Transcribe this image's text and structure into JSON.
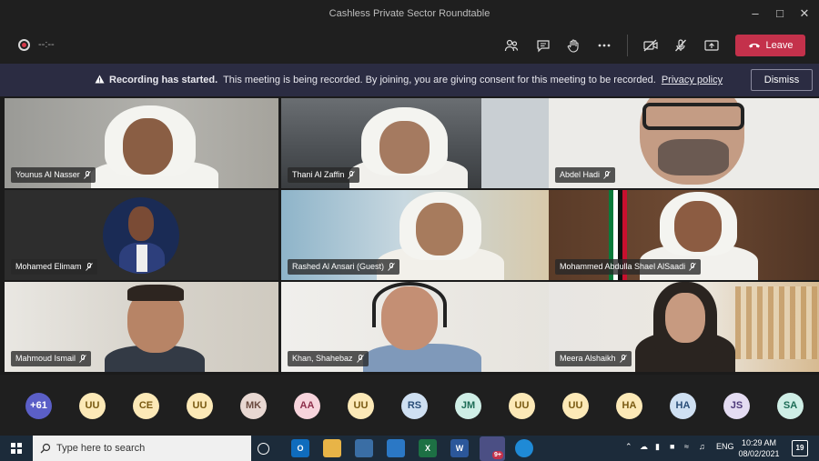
{
  "window": {
    "title": "Cashless Private Sector Roundtable"
  },
  "toolbar": {
    "timer": "--:--",
    "leave_label": "Leave"
  },
  "banner": {
    "bold": "Recording has started.",
    "message": "This meeting is being recorded. By joining, you are giving consent for this meeting to be recorded.",
    "link": "Privacy policy",
    "dismiss": "Dismiss"
  },
  "participants": [
    {
      "name": "Younus Al Nasser"
    },
    {
      "name": "Thani Al Zaffin"
    },
    {
      "name": "Abdel Hadi"
    },
    {
      "name": "Mohamed Elimam"
    },
    {
      "name": "Rashed Al Ansari (Guest)"
    },
    {
      "name": "Mohammed Abdulla Shael AlSaadi"
    },
    {
      "name": "Mahmoud Ismail"
    },
    {
      "name": "Khan, Shahebaz"
    },
    {
      "name": "Meera Alshaikh"
    }
  ],
  "avatars": [
    {
      "initials": "+61",
      "bg": "#5b5fc7",
      "fg": "#ffffff"
    },
    {
      "initials": "UU",
      "bg": "#fce9b7",
      "fg": "#7a5a12"
    },
    {
      "initials": "CE",
      "bg": "#fce9b7",
      "fg": "#7a5a12"
    },
    {
      "initials": "UU",
      "bg": "#fce9b7",
      "fg": "#7a5a12"
    },
    {
      "initials": "MK",
      "bg": "#e8d8d2",
      "fg": "#6b4b40"
    },
    {
      "initials": "AA",
      "bg": "#f7d4dc",
      "fg": "#8e2f4b"
    },
    {
      "initials": "UU",
      "bg": "#fce9b7",
      "fg": "#7a5a12"
    },
    {
      "initials": "RS",
      "bg": "#cfe0f2",
      "fg": "#2a4e78"
    },
    {
      "initials": "JM",
      "bg": "#cfeee6",
      "fg": "#1c6b55"
    },
    {
      "initials": "UU",
      "bg": "#fce9b7",
      "fg": "#7a5a12"
    },
    {
      "initials": "UU",
      "bg": "#fce9b7",
      "fg": "#7a5a12"
    },
    {
      "initials": "HA",
      "bg": "#fce9b7",
      "fg": "#7a5a12"
    },
    {
      "initials": "HA",
      "bg": "#cfe0f2",
      "fg": "#2a4e78"
    },
    {
      "initials": "JS",
      "bg": "#e4dcf2",
      "fg": "#4e3a7a"
    },
    {
      "initials": "SA",
      "bg": "#cfeee6",
      "fg": "#1c6b55"
    }
  ],
  "taskbar": {
    "search_placeholder": "Type here to search",
    "language": "ENG",
    "time": "10:29 AM",
    "date": "08/02/2021",
    "notification_count": "19",
    "teams_badge": "9+"
  },
  "colors": {
    "accent": "#5b5fc7",
    "leave": "#c4314b",
    "banner": "#2b2c42"
  }
}
